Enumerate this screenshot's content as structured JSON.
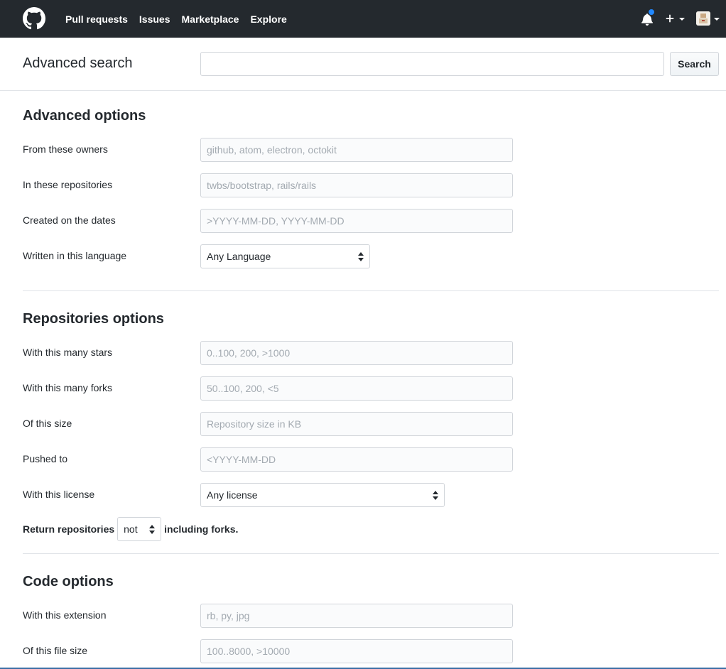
{
  "nav": {
    "items": [
      "Pull requests",
      "Issues",
      "Marketplace",
      "Explore"
    ]
  },
  "search": {
    "title": "Advanced search",
    "button": "Search",
    "value": ""
  },
  "advanced": {
    "title": "Advanced options",
    "owners_label": "From these owners",
    "owners_placeholder": "github, atom, electron, octokit",
    "repos_label": "In these repositories",
    "repos_placeholder": "twbs/bootstrap, rails/rails",
    "dates_label": "Created on the dates",
    "dates_placeholder": ">YYYY-MM-DD, YYYY-MM-DD",
    "language_label": "Written in this language",
    "language_value": "Any Language"
  },
  "repositories": {
    "title": "Repositories options",
    "stars_label": "With this many stars",
    "stars_placeholder": "0..100, 200, >1000",
    "forks_label": "With this many forks",
    "forks_placeholder": "50..100, 200, <5",
    "size_label": "Of this size",
    "size_placeholder": "Repository size in KB",
    "pushed_label": "Pushed to",
    "pushed_placeholder": "<YYYY-MM-DD",
    "license_label": "With this license",
    "license_value": "Any license",
    "return_prefix": "Return repositories",
    "return_value": "not",
    "return_suffix": "including forks."
  },
  "code": {
    "title": "Code options",
    "extension_label": "With this extension",
    "extension_placeholder": "rb, py, jpg",
    "filesize_label": "Of this file size",
    "filesize_placeholder": "100..8000, >10000"
  },
  "colors": {
    "header_bg": "#24292e",
    "notification_dot": "#2188ff"
  },
  "icons": [
    "github-logo-icon",
    "bell-icon",
    "plus-icon",
    "chevron-down-icon",
    "avatar"
  ]
}
